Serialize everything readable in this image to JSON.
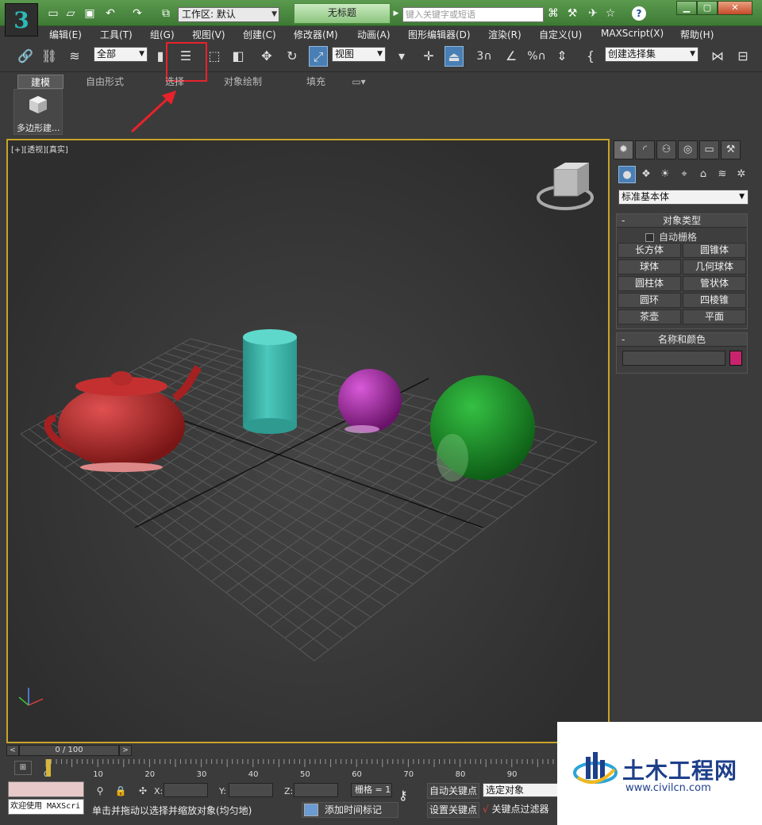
{
  "titlebar": {
    "workspace": "工作区: 默认",
    "document_title": "无标题",
    "search_placeholder": "键入关键字或短语",
    "help": "?"
  },
  "menu": [
    "编辑(E)",
    "工具(T)",
    "组(G)",
    "视图(V)",
    "创建(C)",
    "修改器(M)",
    "动画(A)",
    "图形编辑器(D)",
    "渲染(R)",
    "自定义(U)",
    "MAXScript(X)",
    "帮助(H)"
  ],
  "toolbar": {
    "selection_filter": "全部",
    "ref_coord": "视图",
    "named_selection": "创建选择集"
  },
  "ribbon": {
    "tabs": [
      "建模",
      "自由形式",
      "选择",
      "对象绘制",
      "填充"
    ],
    "poly_button": "多边形建..."
  },
  "viewport": {
    "label": "[+][透视][真实]"
  },
  "command_panel": {
    "category": "标准基本体",
    "object_type_title": "对象类型",
    "autogrid": "自动栅格",
    "buttons": [
      "长方体",
      "圆锥体",
      "球体",
      "几何球体",
      "圆柱体",
      "管状体",
      "圆环",
      "四棱锥",
      "茶壶",
      "平面"
    ],
    "name_color_title": "名称和颜色",
    "swatch_color": "#c8246e"
  },
  "time": {
    "counter": "0 / 100",
    "ruler_ticks": [
      "0",
      "10",
      "20",
      "30",
      "40",
      "50",
      "60",
      "70",
      "80",
      "90"
    ]
  },
  "status": {
    "listener": "欢迎使用 MAXScri",
    "x_label": "X:",
    "y_label": "Y:",
    "z_label": "Z:",
    "grid": "栅格 = 1",
    "prompt": "单击并拖动以选择并缩放对象(均匀地)",
    "add_time_tag": "添加时间标记",
    "auto_key": "自动关键点",
    "set_key": "设置关键点",
    "selected": "选定对象",
    "key_filters": "关键点过滤器"
  },
  "watermark": {
    "title": "土木工程网",
    "url": "www.civilcn.com"
  },
  "colors": {
    "teapot": "#b52a2a",
    "cylinder": "#3fb8ac",
    "small_sphere": "#a82aa8",
    "big_sphere": "#1f9a2a",
    "highlight": "#e8222a"
  }
}
